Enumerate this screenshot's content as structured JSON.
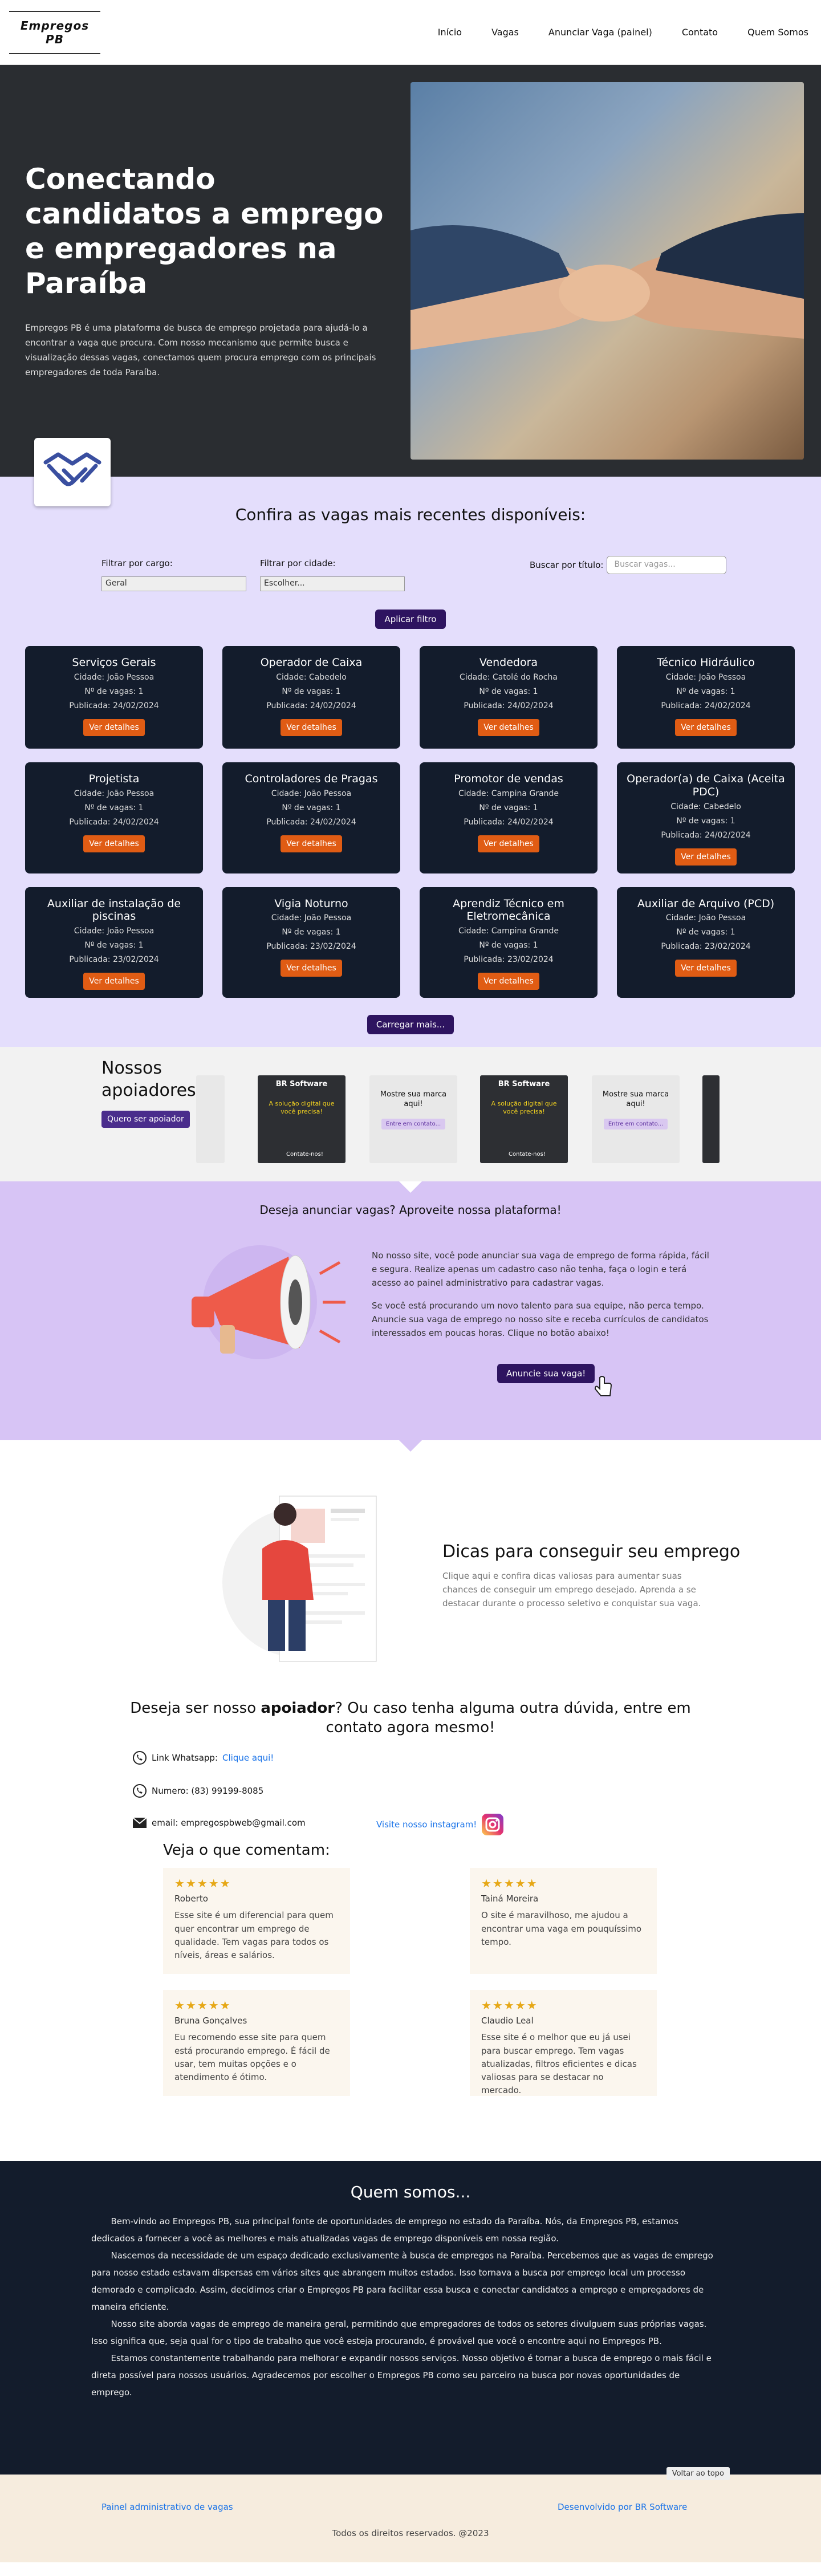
{
  "nav": {
    "logo": "Empregos PB",
    "links": [
      "Início",
      "Vagas",
      "Anunciar Vaga (painel)",
      "Contato",
      "Quem Somos"
    ]
  },
  "hero": {
    "title": "Conectando candidatos a emprego e empregadores na Paraíba",
    "description": "Empregos PB é uma plataforma de busca de emprego projetada para ajudá-lo a encontrar a vaga que procura. Com nosso mecanismo que permite busca e visualização dessas vagas, conectamos quem procura emprego com os principais empregadores de toda Paraíba."
  },
  "jobs": {
    "title": "Confira as vagas mais recentes disponíveis:",
    "filter_cargo_label": "Filtrar por cargo:",
    "filter_cargo_value": "Geral",
    "filter_cidade_label": "Filtrar por cidade:",
    "filter_cidade_value": "Escolher...",
    "search_label": "Buscar por título:",
    "search_placeholder": "Buscar vagas...",
    "apply_button": "Aplicar filtro",
    "details_button": "Ver detalhes",
    "load_more": "Carregar mais...",
    "cards": [
      {
        "title": "Serviços Gerais",
        "city": "Cidade: João Pessoa",
        "vacancies": "Nº de vagas: 1",
        "date": "Publicada: 24/02/2024"
      },
      {
        "title": "Operador de Caixa",
        "city": "Cidade: Cabedelo",
        "vacancies": "Nº de vagas: 1",
        "date": "Publicada: 24/02/2024"
      },
      {
        "title": "Vendedora",
        "city": "Cidade: Catolé do Rocha",
        "vacancies": "Nº de vagas: 1",
        "date": "Publicada: 24/02/2024"
      },
      {
        "title": "Técnico Hidráulico",
        "city": "Cidade: João Pessoa",
        "vacancies": "Nº de vagas: 1",
        "date": "Publicada: 24/02/2024"
      },
      {
        "title": "Projetista",
        "city": "Cidade: João Pessoa",
        "vacancies": "Nº de vagas: 1",
        "date": "Publicada: 24/02/2024"
      },
      {
        "title": "Controladores de Pragas",
        "city": "Cidade: João Pessoa",
        "vacancies": "Nº de vagas: 1",
        "date": "Publicada: 24/02/2024"
      },
      {
        "title": "Promotor de vendas",
        "city": "Cidade: Campina Grande",
        "vacancies": "Nº de vagas: 1",
        "date": "Publicada: 24/02/2024"
      },
      {
        "title": "Operador(a) de Caixa (Aceita PDC)",
        "city": "Cidade: Cabedelo",
        "vacancies": "Nº de vagas: 1",
        "date": "Publicada: 24/02/2024"
      },
      {
        "title": "Auxiliar de instalação de piscinas",
        "city": "Cidade: João Pessoa",
        "vacancies": "Nº de vagas: 1",
        "date": "Publicada: 23/02/2024"
      },
      {
        "title": "Vigia Noturno",
        "city": "Cidade: João Pessoa",
        "vacancies": "Nº de vagas: 1",
        "date": "Publicada: 23/02/2024"
      },
      {
        "title": "Aprendiz Técnico em Eletromecânica",
        "city": "Cidade: Campina Grande",
        "vacancies": "Nº de vagas: 1",
        "date": "Publicada: 23/02/2024"
      },
      {
        "title": "Auxiliar de Arquivo (PCD)",
        "city": "Cidade: João Pessoa",
        "vacancies": "Nº de vagas: 1",
        "date": "Publicada: 23/02/2024"
      }
    ]
  },
  "supporters": {
    "title": "Nossos apoiadores:",
    "button": "Quero ser apoiador",
    "sponsor_name": "BR Software",
    "sponsor_msg": "A solução digital que você precisa!",
    "sponsor_contact": "Contate-nos!",
    "placeholder_text": "Mostre sua marca aqui!",
    "placeholder_button": "Entre em contato..."
  },
  "advert": {
    "title": "Deseja anunciar vagas? Aproveite nossa plataforma!",
    "p1": "No nosso site, você pode anunciar sua vaga de emprego de forma rápida, fácil e segura. Realize apenas um cadastro caso não tenha, faça o login e terá acesso ao painel administrativo para cadastrar vagas.",
    "p2": "Se você está procurando um novo talento para sua equipe, não perca tempo. Anuncie sua vaga de emprego no nosso site e receba currículos de candidatos interessados em poucas horas. Clique no botão abaixo!",
    "button": "Anuncie sua vaga!"
  },
  "tips": {
    "title": "Dicas para conseguir seu emprego",
    "text": "Clique aqui e confira dicas valiosas para aumentar suas chances de conseguir um emprego desejado. Aprenda a se destacar durante o processo seletivo e conquistar sua vaga."
  },
  "contact": {
    "title_pre": "Deseja ser nosso ",
    "title_bold": "apoiador",
    "title_post": "? Ou caso tenha alguma outra dúvida, entre em contato agora mesmo!",
    "whatsapp_label": "Link Whatsapp: ",
    "whatsapp_link": "Clique aqui!",
    "phone": "Numero: (83) 99199-8085",
    "email": "email: empregospbweb@gmail.com",
    "instagram": "Visite nosso instagram!"
  },
  "testimonials": {
    "title": "Veja o que comentam:",
    "stars": "★★★★★",
    "items": [
      {
        "name": "Roberto",
        "text": "Esse site é um diferencial para quem quer encontrar um emprego de qualidade. Tem vagas para todos os níveis, áreas e salários."
      },
      {
        "name": "Tainá Moreira",
        "text": "O site é maravilhoso, me ajudou a encontrar uma vaga em pouquíssimo tempo."
      },
      {
        "name": "Bruna Gonçalves",
        "text": "Eu recomendo esse site para quem está procurando emprego. É fácil de usar, tem muitas opções e o atendimento é ótimo."
      },
      {
        "name": "Claudio Leal",
        "text": "Esse site é o melhor que eu já usei para buscar emprego. Tem vagas atualizadas, filtros eficientes e dicas valiosas para se destacar no mercado."
      }
    ]
  },
  "about": {
    "title": "Quem somos...",
    "paragraphs": [
      "Bem-vindo ao Empregos PB, sua principal fonte de oportunidades de emprego no estado da Paraíba. Nós, da Empregos PB, estamos dedicados a fornecer a você as melhores e mais atualizadas vagas de emprego disponíveis em nossa região.",
      "Nascemos da necessidade de um espaço dedicado exclusivamente à busca de empregos na Paraíba. Percebemos que as vagas de emprego para nosso estado estavam dispersas em vários sites que abrangem muitos estados. Isso tornava a busca por emprego local um processo demorado e complicado. Assim, decidimos criar o Empregos PB para facilitar essa busca e conectar candidatos a emprego e empregadores de maneira eficiente.",
      "Nosso site aborda vagas de emprego de maneira geral, permitindo que empregadores de todos os setores divulguem suas próprias vagas. Isso significa que, seja qual for o tipo de trabalho que você esteja procurando, é provável que você o encontre aqui no Empregos PB.",
      "Estamos constantemente trabalhando para melhorar e expandir nossos serviços. Nosso objetivo é tornar a busca de emprego o mais fácil e direta possível para nossos usuários. Agradecemos por escolher o Empregos PB como seu parceiro na busca por novas oportunidades de emprego."
    ],
    "back_to_top": "Voltar ao topo"
  },
  "footer": {
    "admin_link": "Painel administrativo de vagas",
    "dev_link": "Desenvolvido por BR Software",
    "copyright": "Todos os direitos reservados. @2023"
  }
}
